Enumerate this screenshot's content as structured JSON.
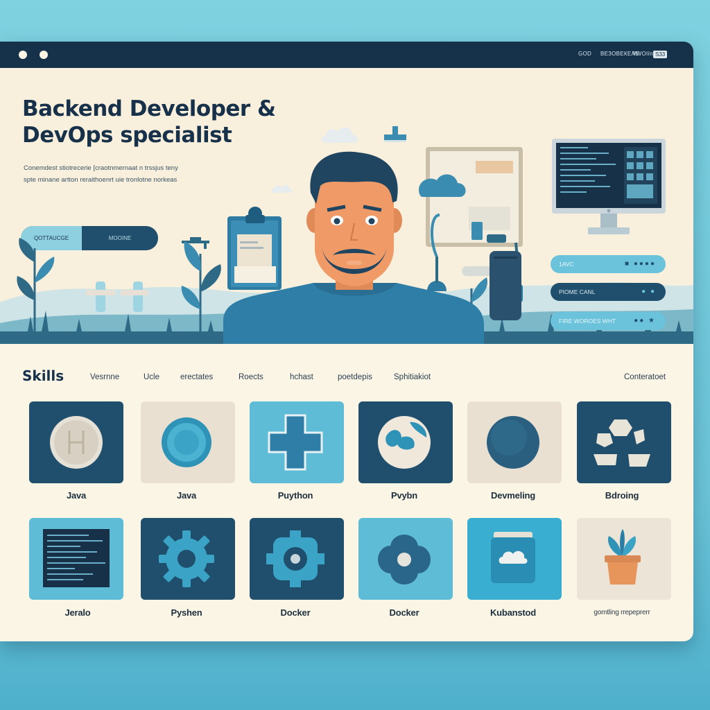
{
  "titlebar": {
    "right_text": "GOD",
    "right_text2": "ВЕЗОВЕКЕЛЕ",
    "right_text3": "VWOIín",
    "badge": "S33"
  },
  "hero": {
    "title": "Backend Developer & DevOps specialist",
    "subtitle_line1": "Conemdest stiotrecerie [craotnmernaat n trssjus teny",
    "subtitle_line2": "spte minane artton reraithoenrt uie tronlotne norkeas",
    "cta_left": "QOTTAUCGE",
    "cta_right": "MOOINE",
    "pills": [
      {
        "label": "1AVC",
        "dots": "■ ●●●●"
      },
      {
        "label": "PIOME CANL",
        "dots": "● ●"
      },
      {
        "label": "FIRE WOROES WHT",
        "dots": "●● ★"
      }
    ]
  },
  "skills": {
    "heading": "Skills",
    "nav": [
      "Vesrnne",
      "Ucle",
      "erectates",
      "Roects",
      "hchast",
      "poetdepis",
      "Sphitiakiot"
    ],
    "contact": "Conteratoet",
    "items": [
      {
        "label": "Java",
        "icon": "coin-icon"
      },
      {
        "label": "Java",
        "icon": "button-icon"
      },
      {
        "label": "Puython",
        "icon": "plus-cross-icon"
      },
      {
        "label": "Pvybn",
        "icon": "globe-icon"
      },
      {
        "label": "Devmeling",
        "icon": "sphere-icon"
      },
      {
        "label": "Bdroing",
        "icon": "hexagon-shapes-icon"
      },
      {
        "label": "Jeralo",
        "icon": "terminal-icon"
      },
      {
        "label": "Pyshen",
        "icon": "gear-icon"
      },
      {
        "label": "Docker",
        "icon": "container-gear-icon"
      },
      {
        "label": "Docker",
        "icon": "flower-icon"
      },
      {
        "label": "Kubanstod",
        "icon": "cloud-folder-icon"
      },
      {
        "label": "gomtling rrepeprerr",
        "icon": "potted-plant-icon"
      }
    ]
  },
  "colors": {
    "navy": "#1f4f6d",
    "teal": "#3aa6c6",
    "light_teal": "#5fbcd6",
    "cream": "#fbf5e6",
    "beige": "#e9e0d2"
  }
}
